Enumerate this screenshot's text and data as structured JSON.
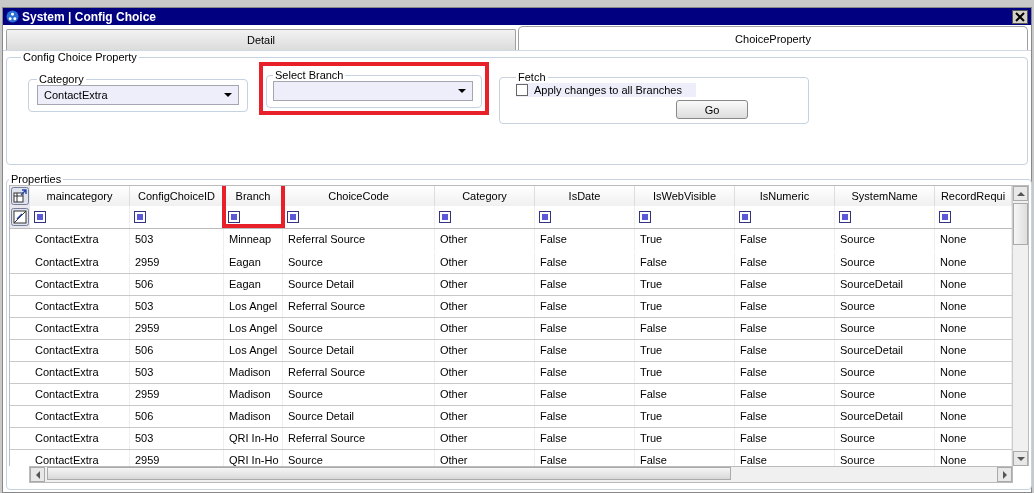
{
  "window": {
    "title": "System | Config Choice"
  },
  "tabs": [
    {
      "label": "Detail",
      "selected": false
    },
    {
      "label": "ChoiceProperty",
      "selected": true
    }
  ],
  "config_group": {
    "legend": "Config Choice Property",
    "category": {
      "legend": "Category",
      "value": "ContactExtra",
      "highlighted": false
    },
    "branch": {
      "legend": "Select Branch",
      "highlighted": true
    },
    "fetch": {
      "legend": "Fetch",
      "checkbox": {
        "label": "Apply changes to all Branches",
        "checked": false
      },
      "button": "Go"
    }
  },
  "properties": {
    "legend": "Properties",
    "columns": [
      {
        "label": "maincategory",
        "highlighted": false
      },
      {
        "label": "ConfigChoiceID",
        "highlighted": false
      },
      {
        "label": "Branch",
        "highlighted": true
      },
      {
        "label": "ChoiceCode",
        "highlighted": false
      },
      {
        "label": "Category",
        "highlighted": false
      },
      {
        "label": "IsDate",
        "highlighted": false
      },
      {
        "label": "IsWebVisible",
        "highlighted": false
      },
      {
        "label": "IsNumeric",
        "highlighted": false
      },
      {
        "label": "SystemName",
        "highlighted": false
      },
      {
        "label": "RecordRequi",
        "highlighted": false
      }
    ],
    "rows": [
      {
        "cells": [
          "ContactExtra",
          "503",
          "Minneap",
          "Referral Source",
          "Other",
          "False",
          "True",
          "False",
          "Source",
          "None"
        ]
      },
      {
        "cells": [
          "ContactExtra",
          "2959",
          "Eagan",
          "Source",
          "Other",
          "False",
          "False",
          "False",
          "Source",
          "None"
        ],
        "joined_above": true
      },
      {
        "cells": [
          "ContactExtra",
          "506",
          "Eagan",
          "Source Detail",
          "Other",
          "False",
          "True",
          "False",
          "SourceDetail",
          "None"
        ],
        "joined_above": false
      },
      {
        "cells": [
          "ContactExtra",
          "503",
          "Los Angel",
          "Referral Source",
          "Other",
          "False",
          "True",
          "False",
          "Source",
          "None"
        ],
        "joined_above": false
      },
      {
        "cells": [
          "ContactExtra",
          "2959",
          "Los Angel",
          "Source",
          "Other",
          "False",
          "False",
          "False",
          "Source",
          "None"
        ],
        "joined_above": false
      },
      {
        "cells": [
          "ContactExtra",
          "506",
          "Los Angel",
          "Source Detail",
          "Other",
          "False",
          "True",
          "False",
          "SourceDetail",
          "None"
        ],
        "joined_above": false
      },
      {
        "cells": [
          "ContactExtra",
          "503",
          "Madison",
          "Referral Source",
          "Other",
          "False",
          "True",
          "False",
          "Source",
          "None"
        ],
        "joined_above": false
      },
      {
        "cells": [
          "ContactExtra",
          "2959",
          "Madison",
          "Source",
          "Other",
          "False",
          "False",
          "False",
          "Source",
          "None"
        ],
        "joined_above": false
      },
      {
        "cells": [
          "ContactExtra",
          "506",
          "Madison",
          "Source Detail",
          "Other",
          "False",
          "True",
          "False",
          "SourceDetail",
          "None"
        ],
        "joined_above": false
      },
      {
        "cells": [
          "ContactExtra",
          "503",
          "QRI In-Ho",
          "Referral Source",
          "Other",
          "False",
          "True",
          "False",
          "Source",
          "None"
        ],
        "joined_above": false
      },
      {
        "cells": [
          "ContactExtra",
          "2959",
          "QRI In-Ho",
          "Source",
          "Other",
          "False",
          "False",
          "False",
          "Source",
          "None"
        ],
        "joined_above": false
      }
    ]
  }
}
